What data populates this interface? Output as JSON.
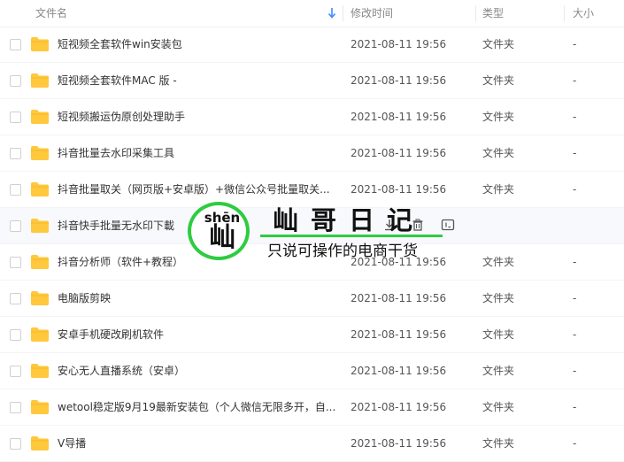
{
  "header": {
    "name_label": "文件名",
    "modified_label": "修改时间",
    "type_label": "类型",
    "size_label": "大小",
    "sort_icon": "sort-down-arrow-icon",
    "accent_color": "#3b8cff"
  },
  "rows": [
    {
      "name": "短视频全套软件win安装包",
      "date": "2021-08-11 19:56",
      "type": "文件夹",
      "size": "-"
    },
    {
      "name": "短视频全套软件MAC 版 -",
      "date": "2021-08-11 19:56",
      "type": "文件夹",
      "size": "-"
    },
    {
      "name": "短视频搬运伪原创处理助手",
      "date": "2021-08-11 19:56",
      "type": "文件夹",
      "size": "-"
    },
    {
      "name": "抖音批量去水印采集工具",
      "date": "2021-08-11 19:56",
      "type": "文件夹",
      "size": "-"
    },
    {
      "name": "抖音批量取关（网页版+安卓版）+微信公众号批量取关...",
      "date": "2021-08-11 19:56",
      "type": "文件夹",
      "size": "-"
    },
    {
      "name": "抖音快手批量无水印下載",
      "date": "",
      "type": "",
      "size": ""
    },
    {
      "name": "抖音分析师（软件+教程）",
      "date": "2021-08-11 19:56",
      "type": "文件夹",
      "size": "-"
    },
    {
      "name": "电脑版剪映",
      "date": "2021-08-11 19:56",
      "type": "文件夹",
      "size": "-"
    },
    {
      "name": "安卓手机硬改刷机软件",
      "date": "2021-08-11 19:56",
      "type": "文件夹",
      "size": "-"
    },
    {
      "name": "安心无人直播系统（安卓）",
      "date": "2021-08-11 19:56",
      "type": "文件夹",
      "size": "-"
    },
    {
      "name": "wetool稳定版9月19最新安装包（个人微信无限多开，自...",
      "date": "2021-08-11 19:56",
      "type": "文件夹",
      "size": "-"
    },
    {
      "name": "V导播",
      "date": "2021-08-11 19:56",
      "type": "文件夹",
      "size": "-"
    }
  ],
  "row_action_icons": [
    "download-icon",
    "delete-icon",
    "rename-icon"
  ],
  "folder_color": "#ffc83d",
  "watermark": {
    "pinyin": "shēn",
    "char": "屾",
    "title": "屾哥日记",
    "subtitle": "只说可操作的电商干货",
    "accent_color": "#2ecc40"
  }
}
